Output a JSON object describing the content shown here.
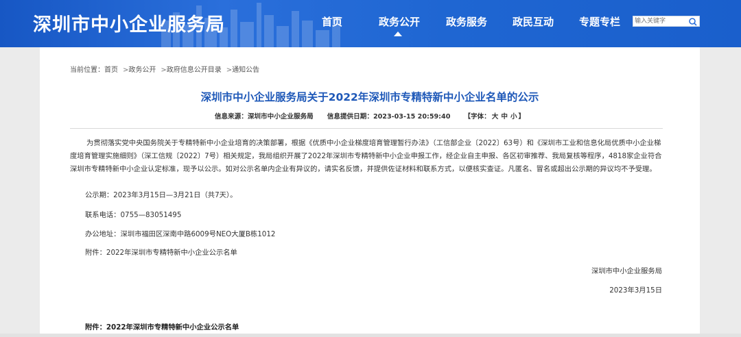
{
  "header": {
    "site_title": "深圳市中小企业服务局",
    "nav": [
      "首页",
      "政务公开",
      "政务服务",
      "政民互动",
      "专题专栏"
    ],
    "active_nav": "政务公开",
    "search_placeholder": "输入关键字"
  },
  "breadcrumb": {
    "prefix": "当前位置：",
    "items": [
      "首页",
      "政务公开",
      "政府信息公开目录",
      "通知公告"
    ],
    "separator": ">"
  },
  "article": {
    "title": "深圳市中小企业服务局关于2022年深圳市专精特新中小企业名单的公示",
    "source_label": "信息来源：",
    "source": "深圳市中小企业服务局",
    "date_label": "信息提供日期：",
    "date": "2023-03-15 20:59:40",
    "font_open": "【字体：",
    "font_sizes": [
      "大",
      "中",
      "小"
    ],
    "font_close": "】",
    "paragraph": "为贯彻落实党中央国务院关于专精特新中小企业培育的决策部署，根据《优质中小企业梯度培育管理暂行办法》（工信部企业〔2022〕63号）和《深圳市工业和信息化局优质中小企业梯度培育管理实施细则》（深工信规〔2022〕7号）相关规定，我局组织开展了2022年深圳市专精特新中小企业申报工作，经企业自主申报、各区初审推荐、我局复核等程序，4818家企业符合深圳市专精特新中小企业认定标准，现予以公示。如对公示名单内企业有异议的，请实名反馈，并提供佐证材料和联系方式，以便核实查证。凡匿名、冒名或超出公示期的异议均不予受理。",
    "period": "公示期：2023年3月15日—3月21日（共7天）。",
    "phone": "联系电话：0755—83051495",
    "address": "办公地址：深圳市福田区深南中路6009号NEO大厦B栋1012",
    "attachment": "附件：2022年深圳市专精特新中小企业公示名单",
    "signature_org": "深圳市中小企业服务局",
    "signature_date": "2023年3月15日",
    "attachment_heading": "附件：2022年深圳市专精特新中小企业公示名单"
  },
  "colors": {
    "header_blue": "#1f63cf",
    "title_blue": "#1e58b8",
    "background": "#ebebeb"
  }
}
